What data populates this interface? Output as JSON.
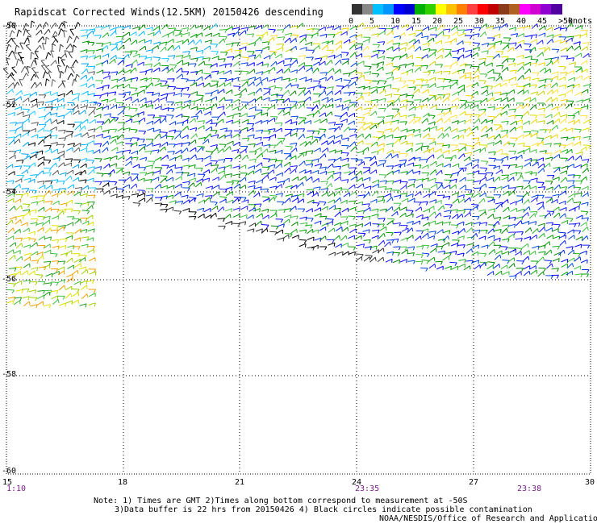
{
  "title": "Rapidscat Corrected Winds(12.5KM) 20150426 descending",
  "legend": {
    "colors": [
      "#333333",
      "#888888",
      "#00c0ff",
      "#0096ff",
      "#0000ff",
      "#0000d0",
      "#00b000",
      "#30d000",
      "#ffff00",
      "#ffc000",
      "#ff8000",
      "#ff4040",
      "#ff0000",
      "#c00000",
      "#8b3a1a",
      "#b06020",
      "#ff00ff",
      "#d000d0",
      "#9000d0",
      "#5000a0"
    ],
    "ticks": [
      "0",
      "5",
      "10",
      "15",
      "20",
      "25",
      "30",
      "35",
      "40",
      "45",
      ">50"
    ],
    "unit": "knots"
  },
  "axes": {
    "lat_labels": [
      "-50",
      "-52",
      "-54",
      "-56",
      "-58",
      "-60"
    ],
    "lon_labels": [
      "15",
      "18",
      "21",
      "24",
      "27",
      "30"
    ],
    "times": [
      "1:10",
      "23:35",
      "23:38"
    ]
  },
  "notes": {
    "line1": "Note: 1) Times are GMT 2)Times along bottom correspond to measurement at -50S",
    "line2": "3)Data buffer is 22 hrs from 20150426 4) Black circles indicate possible contamination",
    "credit": "NOAA/NESDIS/Office of Research and Applications"
  },
  "chart_data": {
    "type": "map",
    "title": "Rapidscat Corrected Winds(12.5KM) 20150426 descending",
    "lat_range": [
      -60,
      -50
    ],
    "lon_range": [
      15,
      30
    ],
    "lat_ticks": [
      -50,
      -52,
      -54,
      -56,
      -58,
      -60
    ],
    "lon_ticks": [
      15,
      18,
      21,
      24,
      27,
      30
    ],
    "grid": "dotted",
    "legend_ticks_knots": [
      0,
      5,
      10,
      15,
      20,
      25,
      30,
      35,
      40,
      45,
      50
    ]
  }
}
